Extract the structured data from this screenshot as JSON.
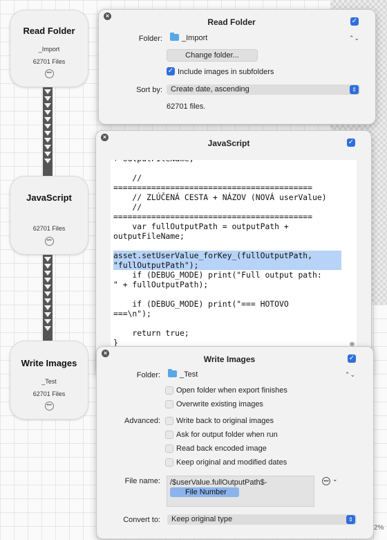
{
  "nodes": [
    {
      "title": "Read Folder",
      "subtitle": "_Import",
      "count": "62701 Files"
    },
    {
      "title": "JavaScript",
      "subtitle": "",
      "count": "62701 Files"
    },
    {
      "title": "Write Images",
      "subtitle": "_Test",
      "count": "62701 Files"
    }
  ],
  "read_folder": {
    "title": "Read Folder",
    "folder_label": "Folder:",
    "folder_value": "_Import",
    "change_folder_button": "Change folder...",
    "include_subfolders_label": "Include images in subfolders",
    "include_subfolders_checked": true,
    "sort_label": "Sort by:",
    "sort_value": "Create date, ascending",
    "file_count": "62701 files.",
    "enabled": true
  },
  "javascript": {
    "title": "JavaScript",
    "enabled": true,
    "code_lines": [
      "+ outputFileName;",
      "",
      "    //",
      "==========================================",
      "    // ZLÚČENÁ CESTA + NÁZOV (NOVÁ userValue)",
      "    //",
      "==========================================",
      "    var fullOutputPath = outputPath +",
      "outputFileName;",
      "",
      "asset.setUserValue_forKey_(fullOutputPath,",
      "\"fullOutputPath\");",
      "    if (DEBUG_MODE) print(\"Full output path:",
      "\" + fullOutputPath);",
      "",
      "    if (DEBUG_MODE) print(\"=== HOTOVO",
      "===\\n\");",
      "",
      "    return true;",
      "}"
    ]
  },
  "write_images": {
    "title": "Write Images",
    "enabled": true,
    "folder_label": "Folder:",
    "folder_value": "_Test",
    "options": [
      {
        "label": "Open folder when export finishes",
        "checked": false
      },
      {
        "label": "Overwrite existing images",
        "checked": false
      }
    ],
    "advanced_label": "Advanced:",
    "advanced_options": [
      {
        "label": "Write back to original images",
        "checked": false
      },
      {
        "label": "Ask for output folder when run",
        "checked": false
      },
      {
        "label": "Read back encoded image",
        "checked": false
      },
      {
        "label": "Keep original and modified dates",
        "checked": false
      }
    ],
    "file_name_label": "File name:",
    "file_name_text": "/$userValue.fullOutputPath$-",
    "file_name_token": "File Number",
    "convert_label": "Convert to:",
    "convert_value": "Keep original type"
  },
  "zoom_text": "2%",
  "colors": {
    "accent": "#2f6fdc",
    "highlight": "#b7d3f7",
    "token": "#8cb4ec"
  }
}
